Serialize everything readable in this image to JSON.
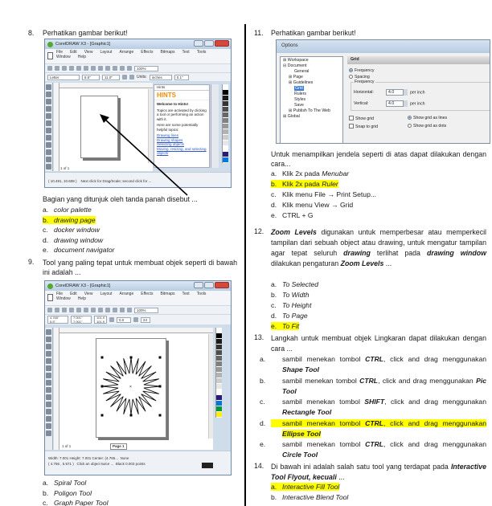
{
  "q8": {
    "number": "8.",
    "prompt": "Perhatikan gambar berikut!",
    "question": "Bagian yang ditunjuk oleh tanda panah disebut ...",
    "options": [
      {
        "letter": "a.",
        "text": "color palette",
        "correct": false
      },
      {
        "letter": "b.",
        "text": "drawing page",
        "correct": true
      },
      {
        "letter": "c.",
        "text": "docker window",
        "correct": false
      },
      {
        "letter": "d.",
        "text": "drawing window",
        "correct": false
      },
      {
        "letter": "e.",
        "text": "document navigator",
        "correct": false
      }
    ],
    "screenshot": {
      "title": "CorelDRAW X3 - [Graphic1]",
      "menu": [
        "File",
        "Edit",
        "View",
        "Layout",
        "Arrange",
        "Effects",
        "Bitmaps",
        "Text",
        "Tools",
        "Window",
        "Help"
      ],
      "zoom": "100%",
      "paper": "Letter",
      "width": "8.5\"",
      "height": "11.0\"",
      "units_label": "Units:",
      "units": "inches",
      "nudge": "0.1\"",
      "docker_title": "Hints",
      "hints_title": "HINTS",
      "hints_welcome": "Welcome to Hints!",
      "hints_body": "Topics are activated by clicking a tool or performing an action with it.",
      "hints_more": "Here are some potentially helpful topics:",
      "hints_links": [
        "Drawing lines",
        "Drawing shapes",
        "Selecting objects",
        "Moving, resizing, and selecting objects"
      ],
      "page_nav": "1 of 1",
      "coords": "( 10.491, 10.608 )",
      "status": "Next click for Drag/Scale; second click for ..."
    }
  },
  "q9": {
    "number": "9.",
    "question": "Tool yang paling tepat untuk membuat objek seperti di bawah ini adalah ...",
    "options": [
      {
        "letter": "a.",
        "text": "Spiral Tool",
        "correct": false
      },
      {
        "letter": "b.",
        "text": "Poligon Tool",
        "correct": false
      },
      {
        "letter": "c.",
        "text": "Graph Paper Tool",
        "correct": false
      }
    ],
    "screenshot": {
      "title": "CorelDRAW X3 - [Graphic1]",
      "menu": [
        "File",
        "Edit",
        "View",
        "Layout",
        "Arrange",
        "Effects",
        "Bitmaps",
        "Text",
        "Tools",
        "Window",
        "Help"
      ],
      "zoom": "100%",
      "x": "4.765\"",
      "y": "5.5\"",
      "w": "7.001\"",
      "h": "7.001\"",
      "sx": "101.9",
      "sy": "101.9",
      "angle": "0.0",
      "points": "24",
      "page_nav": "1 of 1",
      "page_tab": "Page 1",
      "status_line1": "Width: 7.001  Height: 7.001  Center: (4.765...",
      "fill": "None",
      "coords": "( 4.766 , 5.571 )",
      "status_line2": "Click an object twice ...",
      "outline": "Black 0.003 points"
    }
  },
  "q11": {
    "number": "11.",
    "prompt": "Perhatikan gambar berikut!",
    "question": "Untuk menampilkan jendela seperti di atas dapat dilakukan dengan cara...",
    "options": [
      {
        "letter": "a.",
        "prefix": "Klik 2x pada ",
        "emph": "Menubar",
        "correct": false
      },
      {
        "letter": "b.",
        "prefix": "Klik 2x pada ",
        "emph": "Ruler",
        "correct": true
      },
      {
        "letter": "c.",
        "prefix": "Klik menu File → Print Setup...",
        "emph": "",
        "correct": false
      },
      {
        "letter": "d.",
        "prefix": "Klik menu View → Grid",
        "emph": "",
        "correct": false
      },
      {
        "letter": "e.",
        "prefix": "CTRL + G",
        "emph": "",
        "correct": false
      }
    ],
    "dialog": {
      "title": "Options",
      "tree": [
        "Workspace",
        "Document",
        "General",
        "Page",
        "Guidelines",
        "Grid",
        "Rulers",
        "Styles",
        "Save",
        "Publish To The Web",
        "Global"
      ],
      "section": "Grid",
      "radio_frequency": "Frequency",
      "radio_spacing": "Spacing",
      "group_label": "Frequency",
      "horizontal_label": "Horizontal:",
      "horizontal_value": "4.0",
      "vertical_label": "Vertical:",
      "vertical_value": "4.0",
      "unit": "per inch",
      "show_grid": "Show grid",
      "snap_grid": "Snap to grid",
      "as_lines": "Show grid as lines",
      "as_dots": "Show grid as dots"
    }
  },
  "q12": {
    "number": "12.",
    "q_b1": "Zoom Levels",
    "q_t1": " digunakan untuk memperbesar atau memperkecil tampilan dari sebuah object atau drawing, untuk mengatur tampilan agar tepat seluruh ",
    "q_b2": "drawing",
    "q_t2": " terlihat pada ",
    "q_b3": "drawing window",
    "q_t3": " dilakukan pengaturan ",
    "q_b4": "Zoom Levels",
    "q_t4": " ...",
    "options": [
      {
        "letter": "a.",
        "text": "To Selected",
        "correct": false
      },
      {
        "letter": "b.",
        "text": "To Width",
        "correct": false
      },
      {
        "letter": "c.",
        "text": "To Height",
        "correct": false
      },
      {
        "letter": "d.",
        "text": "To Page",
        "correct": false
      },
      {
        "letter": "e.",
        "text": "To Fit",
        "correct": true
      }
    ]
  },
  "q13": {
    "number": "13.",
    "question": "Langkah untuk membuat objek Lingkaran dapat dilakukan dengan cara ...",
    "options": [
      {
        "letter": "a.",
        "t1": "sambil menekan tombol ",
        "key": "CTRL",
        "t2": ", click and drag menggunakan ",
        "tool": "Shape Tool",
        "correct": false
      },
      {
        "letter": "b.",
        "t1": "sambil menekan tombol ",
        "key": "CTRL",
        "t2": ", click and drag menggunakan ",
        "tool": "Pic Tool",
        "correct": false
      },
      {
        "letter": "c.",
        "t1": "sambil menekan tombol ",
        "key": "SHIFT",
        "t2": ", click and drag menggunakan ",
        "tool": "Rectangle Tool",
        "correct": false
      },
      {
        "letter": "d.",
        "t1": "sambil menekan tombol ",
        "key": "CTRL",
        "t2": ", click and drag menggunakan ",
        "tool": "Ellipse Tool",
        "correct": true
      },
      {
        "letter": "e.",
        "t1": "sambil menekan tombol ",
        "key": "CTRL",
        "t2": ", click and drag menggunakan ",
        "tool": "Circle Tool",
        "correct": false
      }
    ]
  },
  "q14": {
    "number": "14.",
    "q_t1": "Di bawah ini adalah salah satu tool yang terdapat pada ",
    "q_b1": "Interactive Tool Flyout, kecuali",
    "q_t2": " ...",
    "options": [
      {
        "letter": "a.",
        "text": "Interactive Fill Tool",
        "correct": true
      },
      {
        "letter": "b.",
        "text": "Interactive Blend Tool",
        "correct": false
      }
    ]
  },
  "colors": {
    "highlight": "#ffff00",
    "hints_orange": "#f08c00",
    "palette": [
      "#ffffff",
      "#000000",
      "#1a1a1a",
      "#333333",
      "#4d4d4d",
      "#666666",
      "#808080",
      "#999999",
      "#b3b3b3",
      "#cccccc",
      "#e6e6e6",
      "#ffffff",
      "#2b1a7a",
      "#0077dd",
      "#00963a",
      "#ffee00"
    ]
  }
}
